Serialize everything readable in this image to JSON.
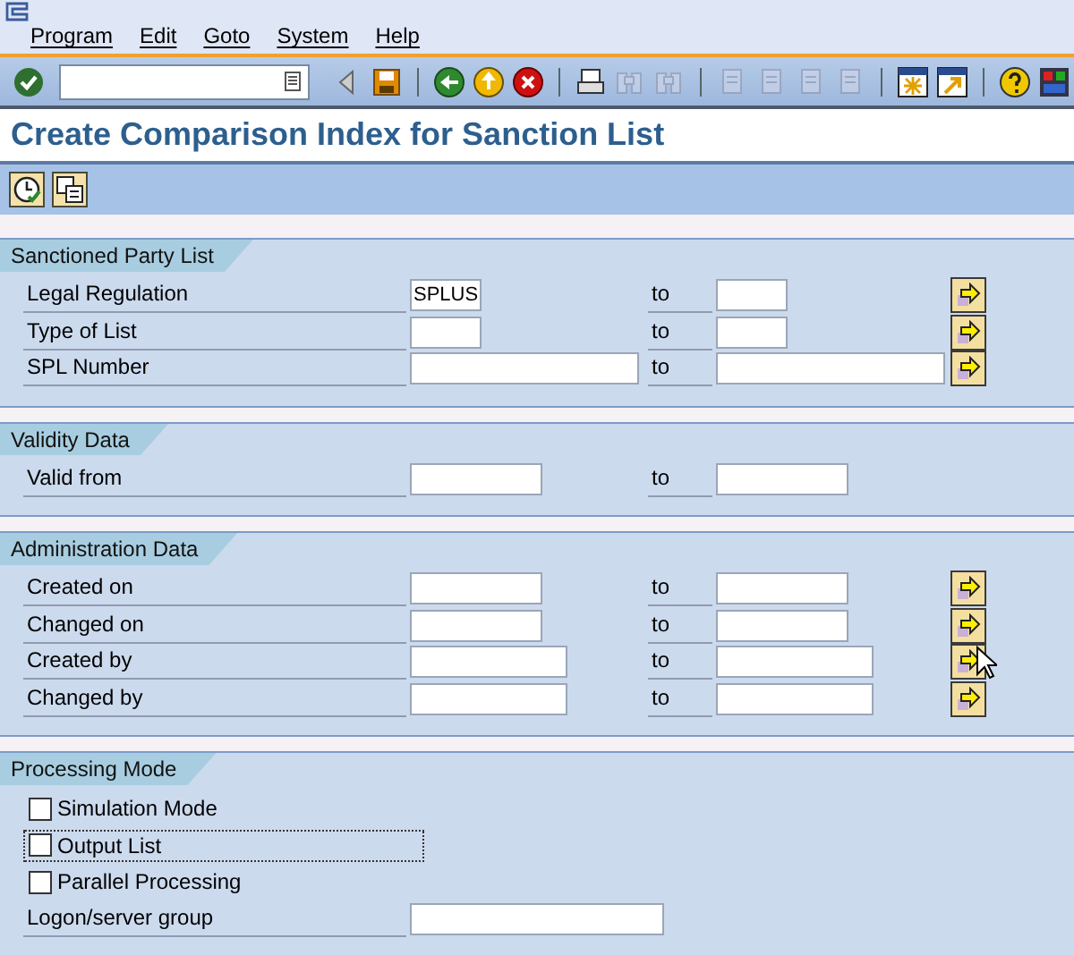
{
  "menu": [
    "Program",
    "Edit",
    "Goto",
    "System",
    "Help"
  ],
  "toolbar": [
    {
      "kind": "enter",
      "disabled": false
    },
    {
      "kind": "command_field"
    },
    {
      "kind": "left",
      "disabled": false
    },
    {
      "kind": "save",
      "disabled": false
    },
    {
      "kind": "sep"
    },
    {
      "kind": "back",
      "disabled": false
    },
    {
      "kind": "exit",
      "disabled": false
    },
    {
      "kind": "cancel",
      "disabled": false
    },
    {
      "kind": "sep"
    },
    {
      "kind": "print",
      "disabled": false
    },
    {
      "kind": "find",
      "disabled": true
    },
    {
      "kind": "find_next",
      "disabled": true
    },
    {
      "kind": "sep"
    },
    {
      "kind": "first_page",
      "disabled": true
    },
    {
      "kind": "prev_page",
      "disabled": true
    },
    {
      "kind": "next_page",
      "disabled": true
    },
    {
      "kind": "last_page",
      "disabled": true
    },
    {
      "kind": "sep"
    },
    {
      "kind": "new_session",
      "disabled": false
    },
    {
      "kind": "shortcut",
      "disabled": false
    },
    {
      "kind": "sep"
    },
    {
      "kind": "help",
      "disabled": false
    },
    {
      "kind": "layout",
      "disabled": false
    }
  ],
  "title": "Create Comparison Index for Sanction List",
  "app_toolbar": [
    {
      "kind": "execute"
    },
    {
      "kind": "variants"
    }
  ],
  "sections": [
    {
      "title": "Sanctioned Party List",
      "rows": [
        {
          "kind": "range",
          "label": "Legal Regulation",
          "from": "SPLUS",
          "to_label": "to",
          "to": "",
          "multiple_selection": true
        },
        {
          "kind": "range",
          "label": "Type of List",
          "from": "",
          "to_label": "to",
          "to": "",
          "multiple_selection": true
        },
        {
          "kind": "range",
          "label": "SPL Number",
          "from": "",
          "to_label": "to",
          "to": "",
          "multiple_selection": true
        }
      ]
    },
    {
      "title": "Validity Data",
      "rows": [
        {
          "kind": "range",
          "label": "Valid from",
          "from": "",
          "to_label": "to",
          "to": "",
          "multiple_selection": false
        }
      ]
    },
    {
      "title": "Administration Data",
      "rows": [
        {
          "kind": "range",
          "label": "Created on",
          "from": "",
          "to_label": "to",
          "to": "",
          "multiple_selection": true
        },
        {
          "kind": "range",
          "label": "Changed on",
          "from": "",
          "to_label": "to",
          "to": "",
          "multiple_selection": true
        },
        {
          "kind": "range",
          "label": "Created by",
          "from": "",
          "to_label": "to",
          "to": "",
          "multiple_selection": true
        },
        {
          "kind": "range",
          "label": "Changed by",
          "from": "",
          "to_label": "to",
          "to": "",
          "multiple_selection": true
        }
      ]
    },
    {
      "title": "Processing Mode",
      "rows": [
        {
          "kind": "checkbox",
          "label": "Simulation Mode",
          "checked": false,
          "focused": false
        },
        {
          "kind": "checkbox",
          "label": "Output List",
          "checked": false,
          "focused": true
        },
        {
          "kind": "checkbox",
          "label": "Parallel Processing",
          "checked": false,
          "focused": false
        },
        {
          "kind": "field",
          "label": "Logon/server group",
          "value": ""
        }
      ]
    }
  ]
}
